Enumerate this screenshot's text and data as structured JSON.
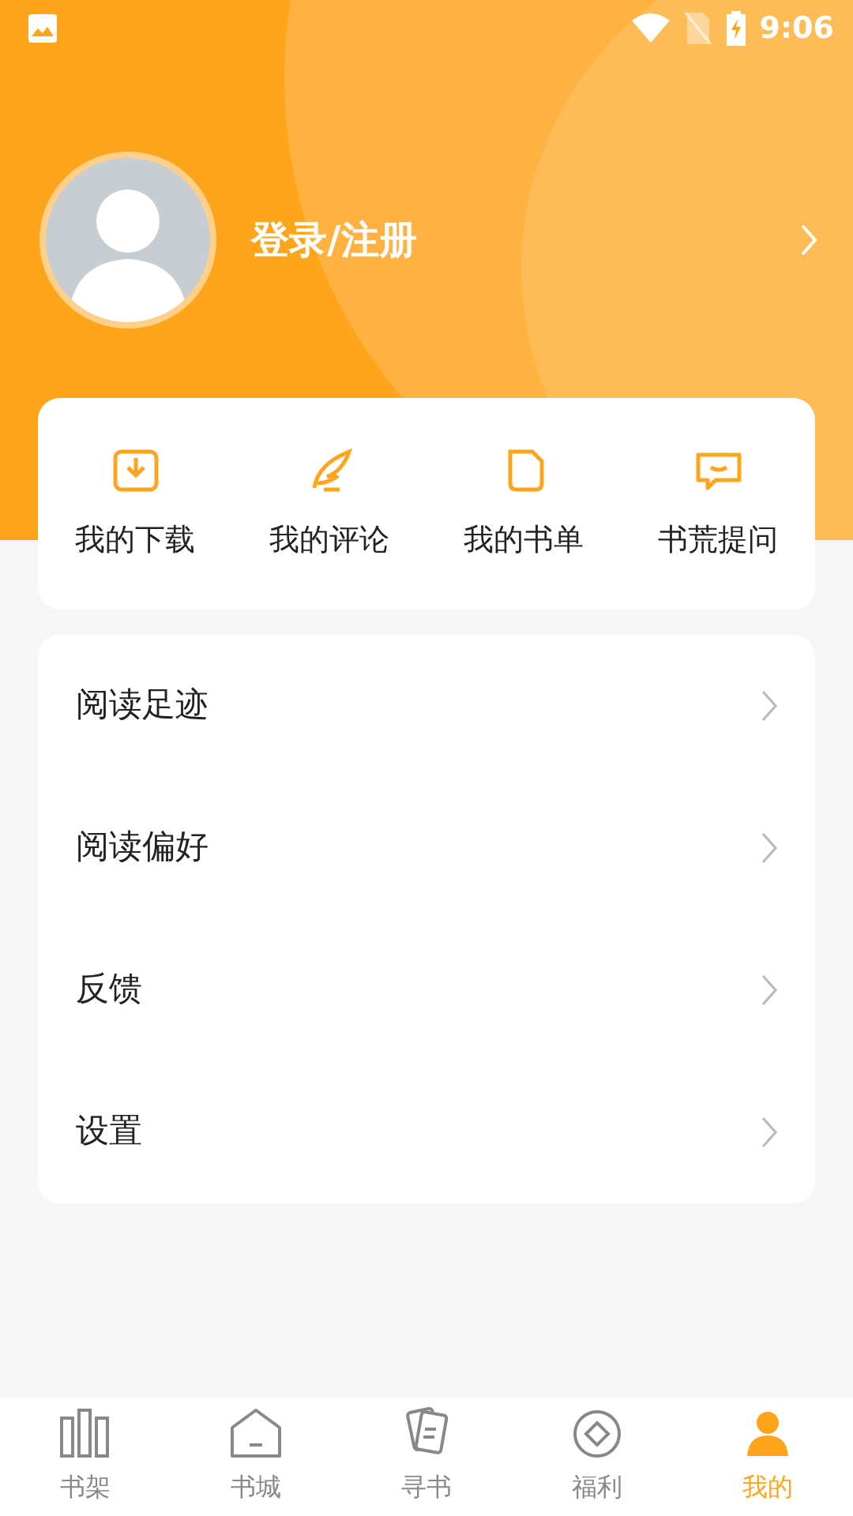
{
  "status_bar": {
    "time": "9:06"
  },
  "profile": {
    "login_label": "登录/注册"
  },
  "quick_actions": [
    {
      "label": "我的下载",
      "kind": "download"
    },
    {
      "label": "我的评论",
      "kind": "feather"
    },
    {
      "label": "我的书单",
      "kind": "page"
    },
    {
      "label": "书荒提问",
      "kind": "chat"
    }
  ],
  "menu": [
    "阅读足迹",
    "阅读偏好",
    "反馈",
    "设置"
  ],
  "tabs": [
    {
      "label": "书架",
      "kind": "shelf",
      "selected": false
    },
    {
      "label": "书城",
      "kind": "home",
      "selected": false
    },
    {
      "label": "寻书",
      "kind": "cards",
      "selected": false
    },
    {
      "label": "福利",
      "kind": "gift",
      "selected": false
    },
    {
      "label": "我的",
      "kind": "person",
      "selected": true
    }
  ]
}
